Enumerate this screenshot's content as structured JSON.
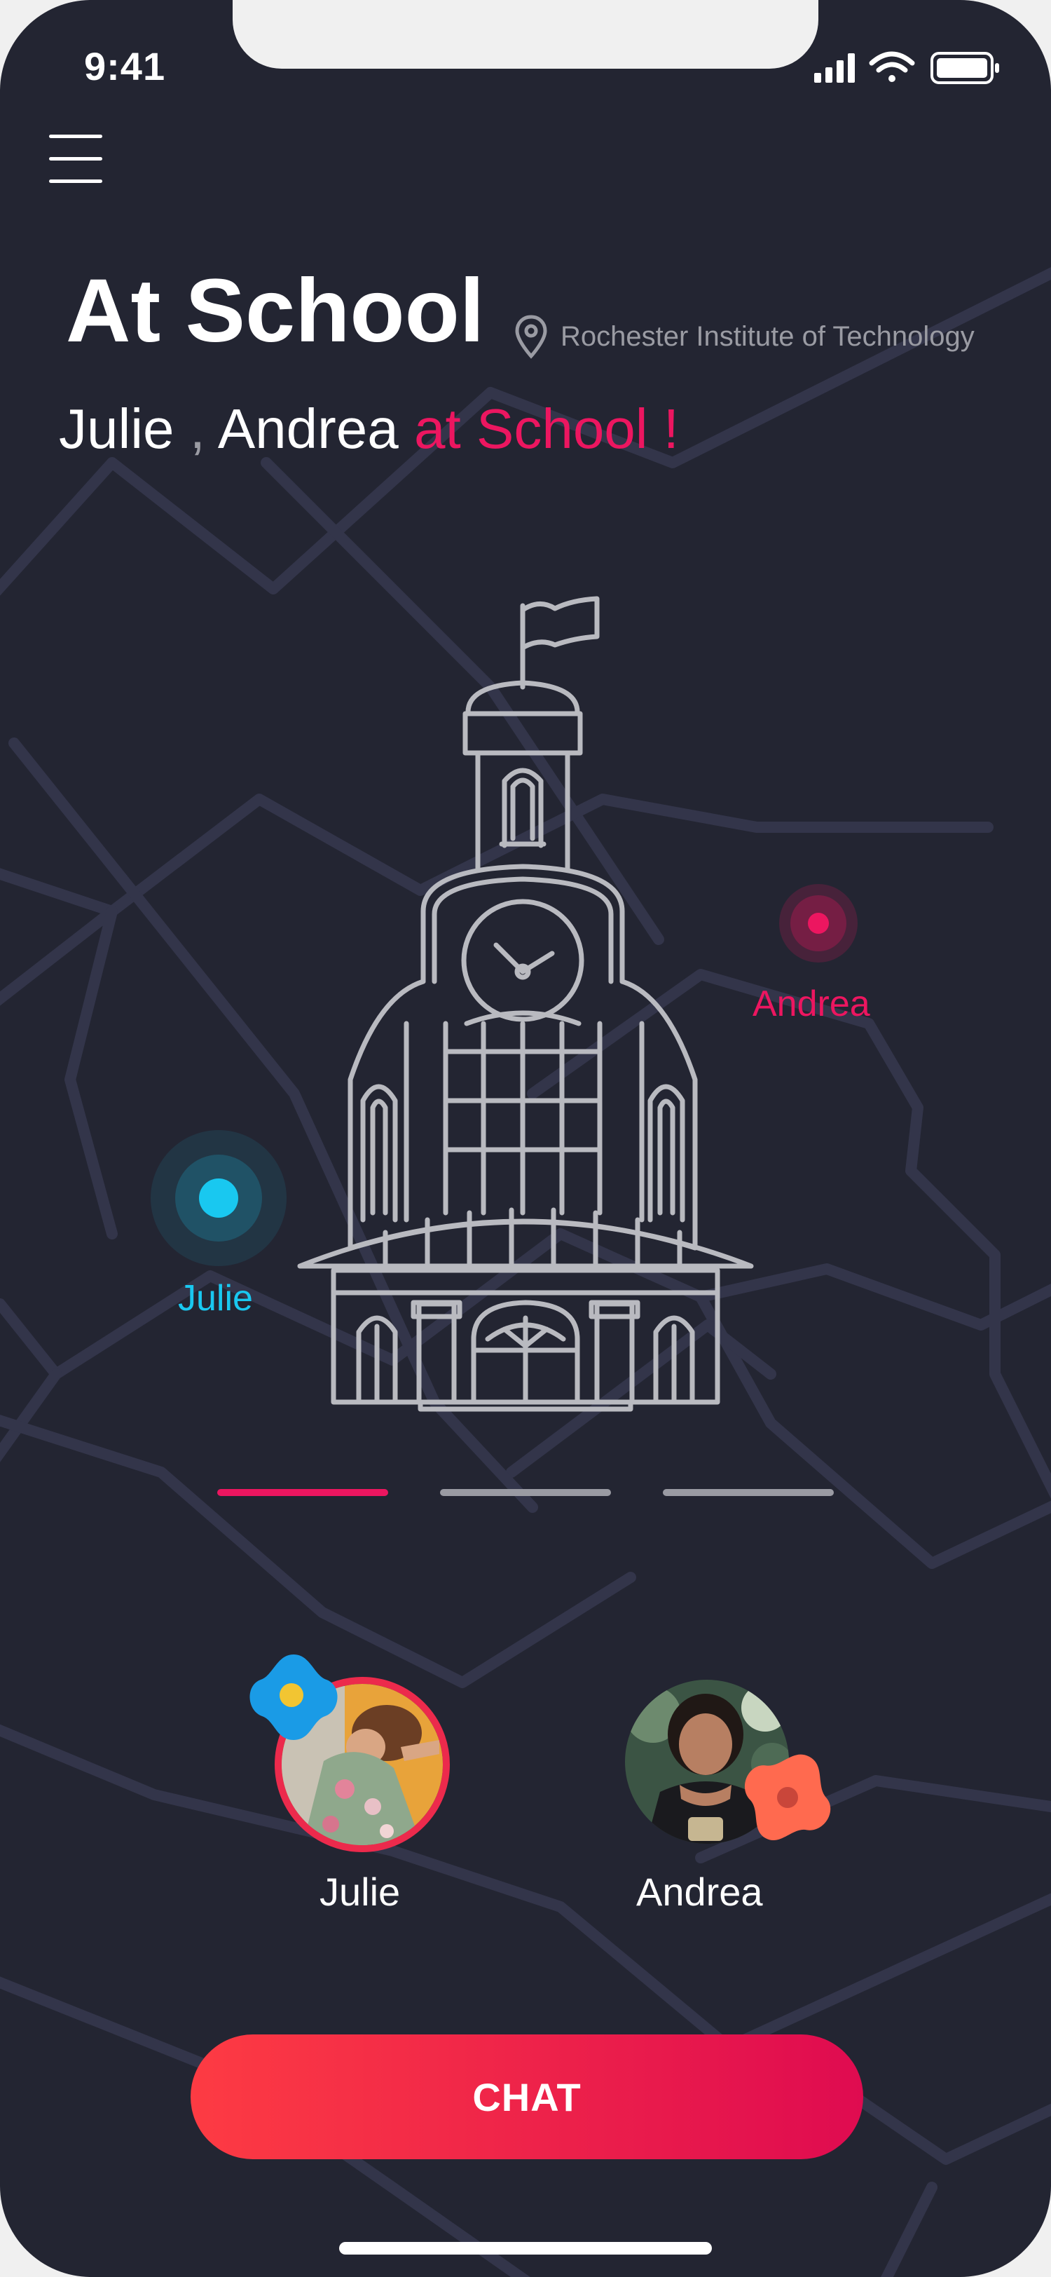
{
  "status_bar": {
    "time": "9:41"
  },
  "header": {
    "title": "At School",
    "location": "Rochester Institute of Technology"
  },
  "subtitle": {
    "name1": "Julie",
    "separator": ",",
    "name2": "Andrea",
    "suffix": "at School !"
  },
  "map": {
    "pins": [
      {
        "label": "Andrea",
        "color": "#ec1660"
      },
      {
        "label": "Julie",
        "color": "#19c8f0"
      }
    ]
  },
  "pager": {
    "count": 3,
    "active_index": 0
  },
  "friends": [
    {
      "name": "Julie"
    },
    {
      "name": "Andrea"
    }
  ],
  "actions": {
    "chat_label": "CHAT"
  },
  "colors": {
    "background": "#232532",
    "accent_pink": "#ec1660",
    "accent_cyan": "#19c8f0",
    "road": "#33354a",
    "button_gradient_start": "#fd3b43",
    "button_gradient_end": "#df0b50"
  }
}
